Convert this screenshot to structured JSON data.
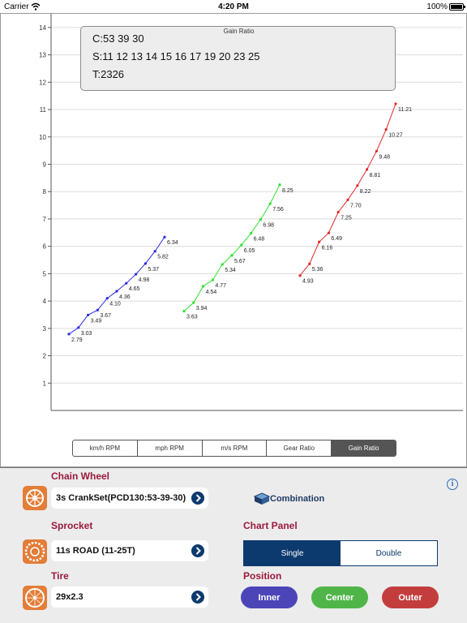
{
  "status_bar": {
    "carrier": "Carrier",
    "time": "4:20 PM",
    "battery": "100%"
  },
  "info_box": {
    "title": "Gain Ratio",
    "chainring_line": "C:53 39 30",
    "sprocket_line": "S:11 12 13 14 15 16 17 19 20 23 25",
    "tire_line": "T:2326"
  },
  "chart_data": {
    "type": "line",
    "x": [
      "11",
      "12",
      "13",
      "14",
      "15",
      "16",
      "17",
      "19",
      "20",
      "23",
      "25"
    ],
    "ylim": [
      0,
      14.5
    ],
    "yticks": [
      1,
      2,
      3,
      4,
      5,
      6,
      7,
      8,
      9,
      10,
      11,
      12,
      13,
      14
    ],
    "grid": "horizontal",
    "series": [
      {
        "color": "#2a2ae0",
        "values": [
          2.79,
          3.03,
          3.49,
          3.67,
          4.1,
          4.36,
          4.65,
          4.98,
          5.37,
          5.82,
          6.34
        ],
        "labels": [
          "2.79",
          "3.03",
          "3.49",
          "3.67",
          "4.10",
          "4.36",
          "4.65",
          "4.98",
          "5.37",
          "5.82",
          "6.34"
        ]
      },
      {
        "color": "#2ee02e",
        "values": [
          3.63,
          3.94,
          4.54,
          4.77,
          5.34,
          5.67,
          6.05,
          6.48,
          6.98,
          7.56,
          8.25
        ],
        "labels": [
          "3.63",
          "3.94",
          "4.54",
          "4.77",
          "5.34",
          "5.67",
          "6.05",
          "6.48",
          "6.98",
          "7.56",
          "8.25"
        ]
      },
      {
        "color": "#e22a2a",
        "values": [
          4.93,
          5.36,
          6.16,
          6.49,
          7.25,
          7.7,
          8.22,
          8.81,
          9.48,
          10.27,
          11.21
        ],
        "labels": [
          "4.93",
          "5.36",
          "6.16",
          "6.49",
          "7.25",
          "7.70",
          "8.22",
          "8.81",
          "9.48",
          "10.27",
          "11.21"
        ]
      }
    ]
  },
  "chart_tabs": [
    {
      "label": "km/h RPM",
      "active": false
    },
    {
      "label": "mph RPM",
      "active": false
    },
    {
      "label": "m/s RPM",
      "active": false
    },
    {
      "label": "Gear Ratio",
      "active": false
    },
    {
      "label": "Gain Ratio",
      "active": true
    }
  ],
  "panel": {
    "chain_wheel": {
      "label": "Chain Wheel",
      "value": "3s CrankSet(PCD130:53-39-30)"
    },
    "sprocket": {
      "label": "Sprocket",
      "value": "11s ROAD (11-25T)"
    },
    "tire": {
      "label": "Tire",
      "value": "29x2.3"
    },
    "combination_label": "Combination",
    "info_icon": "i",
    "chart_panel": {
      "label": "Chart Panel",
      "options": [
        "Single",
        "Double"
      ],
      "selected": "Single"
    },
    "position": {
      "label": "Position",
      "buttons": [
        "Inner",
        "Center",
        "Outer"
      ]
    }
  },
  "colors": {
    "accent": "#0c3a6e",
    "section_label": "#9b1a3c",
    "inner": "#4b45b8",
    "center": "#4fb548",
    "outer": "#c43d3d",
    "tile": "#e37d37"
  }
}
